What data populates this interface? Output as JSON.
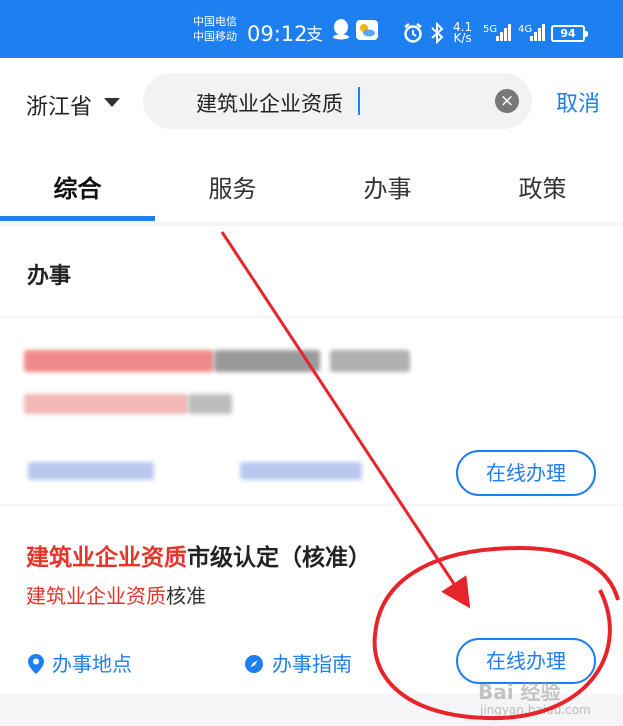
{
  "status_bar": {
    "carrier_1": "中国电信",
    "carrier_2": "中国移动",
    "time": "09:12",
    "net_speed_value": "4.1",
    "net_speed_unit": "K/s",
    "network_1": "5G",
    "network_2": "4G",
    "battery": "94",
    "icons": [
      "alipay-icon",
      "qq-icon",
      "weather-icon",
      "alarm-icon",
      "bluetooth-icon"
    ]
  },
  "search": {
    "province": "浙江省",
    "query": "建筑业企业资质",
    "cancel_label": "取消"
  },
  "tabs": [
    {
      "label": "综合",
      "active": true
    },
    {
      "label": "服务",
      "active": false
    },
    {
      "label": "办事",
      "active": false
    },
    {
      "label": "政策",
      "active": false
    }
  ],
  "section": {
    "title": "办事"
  },
  "results": [
    {
      "blurred": true,
      "action_label": "在线办理"
    },
    {
      "title_highlight": "建筑业企业资质",
      "title_rest": "市级认定（核准）",
      "subtitle_highlight": "建筑业企业资质",
      "subtitle_rest": "核准",
      "location_label": "办事地点",
      "guide_label": "办事指南",
      "action_label": "在线办理"
    }
  ],
  "watermark": {
    "brand": "Bai 经验",
    "url": "jingyan.baidu.com"
  },
  "colors": {
    "accent": "#1e7ff0",
    "highlight": "#e5342a",
    "annotation": "#e8242b"
  }
}
